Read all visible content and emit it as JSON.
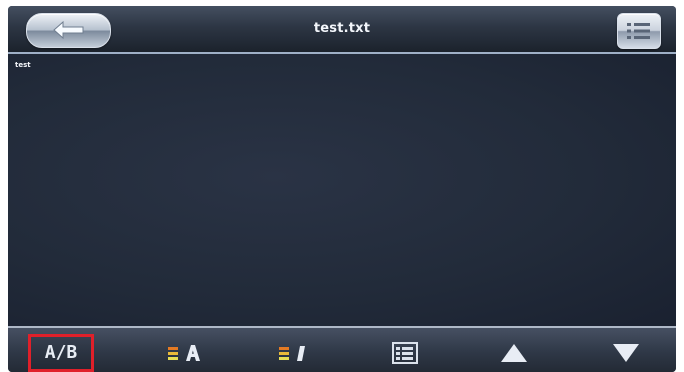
{
  "header": {
    "title": "test.txt"
  },
  "content": {
    "text": "test"
  },
  "toolbar": {
    "ab_label": "A/B",
    "buttons": [
      {
        "name": "ab-button",
        "label": "A/B",
        "icon": "ab-text-icon"
      },
      {
        "name": "font-size-button",
        "icon": "font-size-icon"
      },
      {
        "name": "font-color-button",
        "icon": "font-color-icon"
      },
      {
        "name": "text-options-button",
        "icon": "text-options-icon"
      },
      {
        "name": "scroll-up-button",
        "icon": "up-arrow-icon"
      },
      {
        "name": "scroll-down-button",
        "icon": "down-arrow-icon"
      }
    ]
  },
  "colors": {
    "background": "#1d2430",
    "highlight": "#e0202a",
    "text": "#f4f6fa"
  }
}
